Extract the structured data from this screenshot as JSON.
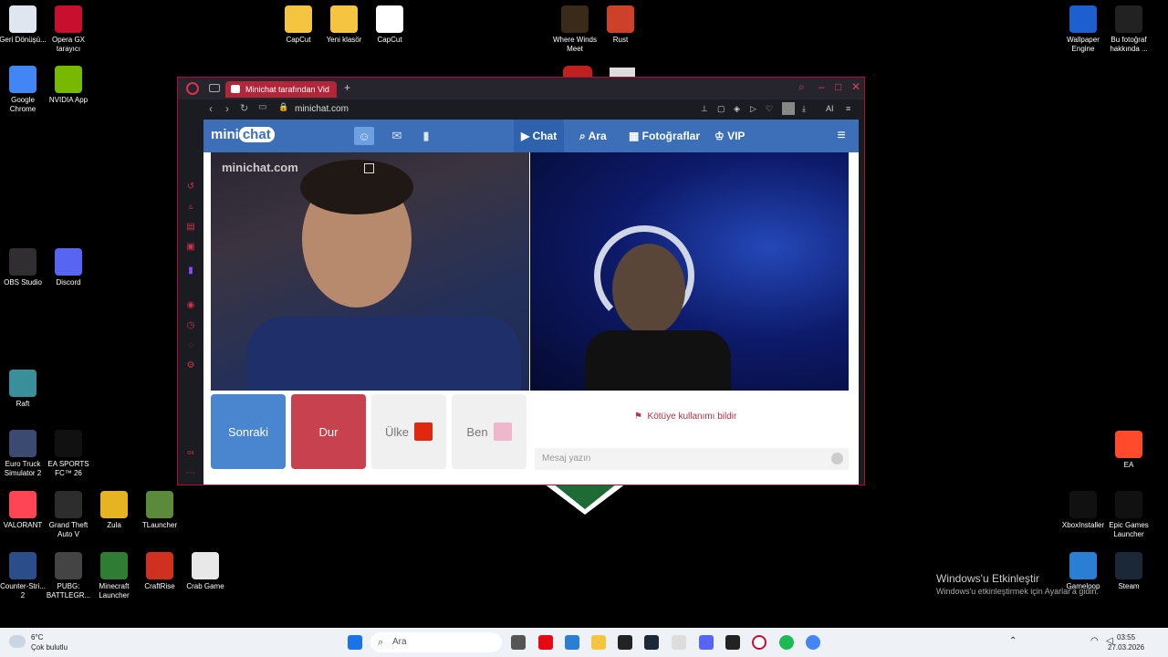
{
  "desktop_left": [
    {
      "name": "recycle-bin-icon",
      "label": "Geri Dönüşü...",
      "color": "#dfe6f0"
    },
    {
      "name": "opera-gx-icon",
      "label": "Opera GX tarayıcı",
      "color": "#c8102e"
    },
    {
      "name": "google-chrome-icon",
      "label": "Google Chrome",
      "color": "#4285f4"
    },
    {
      "name": "nvidia-app-icon",
      "label": "NVIDIA App",
      "color": "#76b900"
    },
    {
      "name": "obs-studio-icon",
      "label": "OBS Studio",
      "color": "#302e31"
    },
    {
      "name": "discord-icon",
      "label": "Discord",
      "color": "#5865f2"
    },
    {
      "name": "raft-icon",
      "label": "Raft",
      "color": "#3a8f9a"
    },
    {
      "name": "euro-truck-icon",
      "label": "Euro Truck Simulator 2",
      "color": "#3a4a70"
    },
    {
      "name": "ea-fc-icon",
      "label": "EA SPORTS FC™ 26",
      "color": "#111111"
    },
    {
      "name": "valorant-icon",
      "label": "VALORANT",
      "color": "#fd4556"
    },
    {
      "name": "gta-icon",
      "label": "Grand Theft Auto V",
      "color": "#2d2d2d"
    },
    {
      "name": "zula-icon",
      "label": "Zula",
      "color": "#e6b422"
    },
    {
      "name": "tlauncher-icon",
      "label": "TLauncher",
      "color": "#5a8a3a"
    },
    {
      "name": "counter-strike-icon",
      "label": "Counter-Stri... 2",
      "color": "#2b4e8a"
    },
    {
      "name": "pubg-icon",
      "label": "PUBG: BATTLEGR...",
      "color": "#444444"
    },
    {
      "name": "minecraft-launcher-icon",
      "label": "Minecraft Launcher",
      "color": "#2e7d32"
    },
    {
      "name": "craftrise-icon",
      "label": "CraftRise",
      "color": "#d03020"
    },
    {
      "name": "crab-game-icon",
      "label": "Crab Game",
      "color": "#e8e8e8"
    }
  ],
  "desktop_top": [
    {
      "name": "folder-capcut-icon",
      "label": "CapCut",
      "color": "#f5c542"
    },
    {
      "name": "folder-yeni-klasor-icon",
      "label": "Yeni klasör",
      "color": "#f5c542"
    },
    {
      "name": "capcut-app-icon",
      "label": "CapCut",
      "color": "#ffffff"
    },
    {
      "name": "where-winds-meet-icon",
      "label": "Where Winds Meet",
      "color": "#3a2a1a"
    },
    {
      "name": "rust-icon",
      "label": "Rust",
      "color": "#cd412b"
    }
  ],
  "desktop_right": [
    {
      "name": "wallpaper-engine-icon",
      "label": "Wallpaper Engine",
      "color": "#1e5fd0"
    },
    {
      "name": "bu-fotograf-icon",
      "label": "Bu fotoğraf hakkında ...",
      "color": "#222222"
    },
    {
      "name": "ea-app-icon",
      "label": "EA",
      "color": "#ff4b2b"
    },
    {
      "name": "xbox-installer-icon",
      "label": "XboxInstaller",
      "color": "#111111"
    },
    {
      "name": "epic-games-icon",
      "label": "Epic Games Launcher",
      "color": "#111111"
    },
    {
      "name": "gameloop-icon",
      "label": "Gameloop",
      "color": "#2a7fd4"
    },
    {
      "name": "steam-icon",
      "label": "Steam",
      "color": "#1b2838"
    }
  ],
  "browser": {
    "tab_title": "Minichat tarafından Vid",
    "url": "minichat.com",
    "ai_label": "AI"
  },
  "minichat": {
    "logo_mini": "mini",
    "logo_chat": "chat",
    "nav": {
      "chat": "Chat",
      "ara": "Ara",
      "fotograflar": "Fotoğraflar",
      "vip": "VIP"
    },
    "watermark": "minichat.com",
    "buttons": {
      "sonraki": "Sonraki",
      "dur": "Dur",
      "ulke": "Ülke",
      "ben": "Ben"
    },
    "report": "Kötüye kullanımı bildir",
    "message_placeholder": "Mesaj yazın"
  },
  "activation": {
    "title": "Windows'u Etkinleştir",
    "subtitle": "Windows'u etkinleştirmek için Ayarlar'a gidin."
  },
  "taskbar": {
    "weather_temp": "6°C",
    "weather_desc": "Çok bulutlu",
    "search_placeholder": "Ara",
    "time": "03:55",
    "date": "27.03.2026"
  }
}
